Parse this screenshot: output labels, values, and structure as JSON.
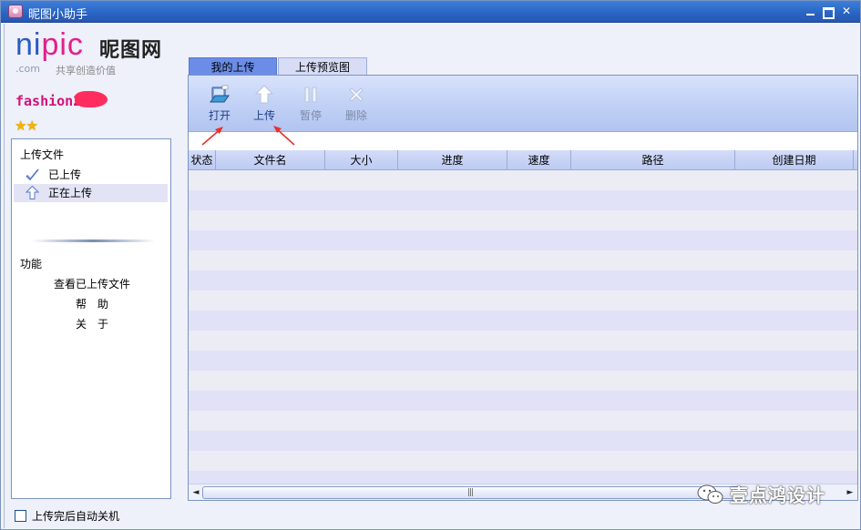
{
  "window": {
    "title": "昵图小助手"
  },
  "logo": {
    "brand_n": "ni",
    "brand_pic": "pic",
    "brand_cn": "昵图网",
    "dotcom": ".com",
    "slogan": "共享创造价值"
  },
  "user": {
    "name": "fashion2",
    "stars": "★★"
  },
  "sidebar": {
    "upload_heading": "上传文件",
    "items": [
      {
        "label": "已上传",
        "icon": "checkmark-icon"
      },
      {
        "label": "正在上传",
        "icon": "up-arrow-icon"
      }
    ],
    "functions_heading": "功能",
    "functions": [
      {
        "label": "查看已上传文件"
      },
      {
        "label": "帮　助"
      },
      {
        "label": "关　于"
      }
    ],
    "auto_shutdown_label": "上传完后自动关机"
  },
  "tabs": [
    {
      "label": "我的上传",
      "active": true
    },
    {
      "label": "上传预览图",
      "active": false
    }
  ],
  "toolbar": {
    "buttons": [
      {
        "label": "打开",
        "icon": "open-folder-icon",
        "enabled": true
      },
      {
        "label": "上传",
        "icon": "upload-arrow-icon",
        "enabled": true
      },
      {
        "label": "暂停",
        "icon": "pause-icon",
        "enabled": false
      },
      {
        "label": "删除",
        "icon": "delete-x-icon",
        "enabled": false
      }
    ]
  },
  "table": {
    "columns": [
      "状态",
      "文件名",
      "大小",
      "进度",
      "速度",
      "路径",
      "创建日期"
    ]
  },
  "scrollbar": {
    "left_arrow": "◄",
    "right_arrow": "►",
    "grip": "|||"
  },
  "watermark": {
    "text": "壹点鸿设计"
  },
  "colors": {
    "titlebar": "#2a63c3",
    "brand_blue": "#2a5bc4",
    "brand_pink": "#e31f8a",
    "active_tab": "#6b8de8",
    "annotation_red": "#e8312e"
  }
}
